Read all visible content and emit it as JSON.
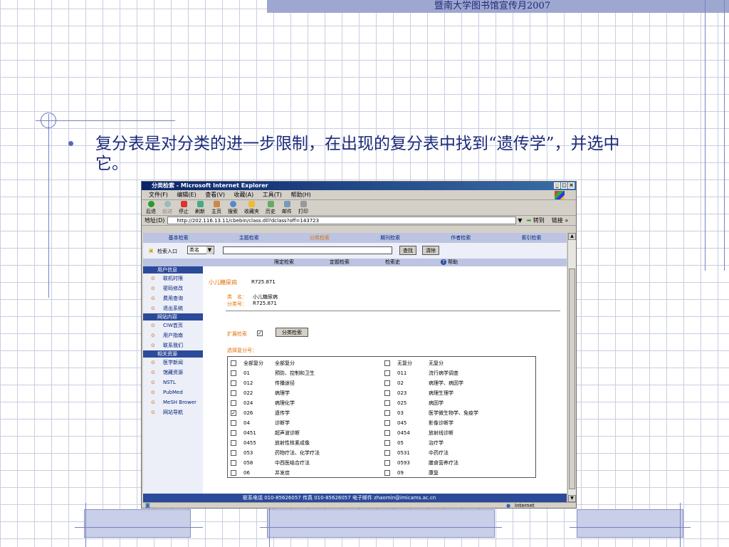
{
  "slide": {
    "header": "暨南大学图书馆宣传月2007",
    "bullet_text": "复分表是对分类的进一步限制，在出现的复分表中找到“遗传学”，并选中它。"
  },
  "window": {
    "title": "分类检索 - Microsoft Internet Explorer",
    "menu": [
      "文件(F)",
      "编辑(E)",
      "查看(V)",
      "收藏(A)",
      "工具(T)",
      "帮助(H)"
    ],
    "toolbar": [
      "后退",
      "前进",
      "停止",
      "刷新",
      "主页",
      "搜索",
      "收藏夹",
      "历史",
      "邮件",
      "打印"
    ],
    "address_label": "地址(D)",
    "address": "http://202.116.13.11/cbebin/class.dll?dclass?off=143723",
    "go": "转到",
    "links": "链接 »",
    "status": "Internet"
  },
  "site": {
    "nav": [
      "基本检索",
      "主题检索",
      "分类检索",
      "期刊检索",
      "作者检索",
      "索引检索"
    ],
    "active_nav": "分类检索",
    "search_entry": "检索入口",
    "search_select": "类名",
    "search_value": "",
    "search_btn": "查找",
    "clear_btn": "清除",
    "subnav": [
      "限定检索",
      "定题检索",
      "检索史",
      "帮助"
    ],
    "side_sections": [
      {
        "head": "用户信息",
        "items": [
          "联机时限",
          "密码修改",
          "费用查询",
          "退出系统"
        ]
      },
      {
        "head": "网站内容",
        "items": [
          "CIW首页",
          "用户指南",
          "联系我们"
        ]
      },
      {
        "head": "相关资源",
        "items": [
          "医学新闻",
          "馆藏资源",
          "NSTL",
          "PubMed",
          "MeSH Brower",
          "网站导航"
        ]
      }
    ],
    "class_title": "小儿糖尿病",
    "class_code": "R725.871",
    "class_name_label": "类　名：",
    "class_name": "小儿糖尿病",
    "class_no_label": "分类号：",
    "class_no": "R725.871",
    "expand_label": "扩展检索",
    "classify_btn": "分类检索",
    "select_label": "选择复分号：",
    "footer": "联系电话 010-85626057    传真 010-85626057    电子邮件 zhaomin@imicams.ac.cn",
    "table": [
      [
        "全部复分",
        "全部复分",
        "无复分",
        "无复分"
      ],
      [
        "01",
        "预防、控制和卫生",
        "011",
        "流行病学调查"
      ],
      [
        "012",
        "传播途径",
        "02",
        "病理学、病因学"
      ],
      [
        "022",
        "病理学",
        "023",
        "病理生理学"
      ],
      [
        "024",
        "病理化学",
        "025",
        "病因学"
      ],
      [
        "026",
        "遗传学",
        "03",
        "医学微生物学、免疫学"
      ],
      [
        "04",
        "诊断学",
        "045",
        "影像诊断学"
      ],
      [
        "0451",
        "超声波诊断",
        "0454",
        "放射线诊断"
      ],
      [
        "0455",
        "放射性核素成像",
        "05",
        "治疗学"
      ],
      [
        "053",
        "药物疗法、化学疗法",
        "0531",
        "中药疗法"
      ],
      [
        "058",
        "中西医结合疗法",
        "0593",
        "膳食营养疗法"
      ],
      [
        "06",
        "并发症",
        "09",
        "康复"
      ]
    ],
    "checked_row": 5
  }
}
